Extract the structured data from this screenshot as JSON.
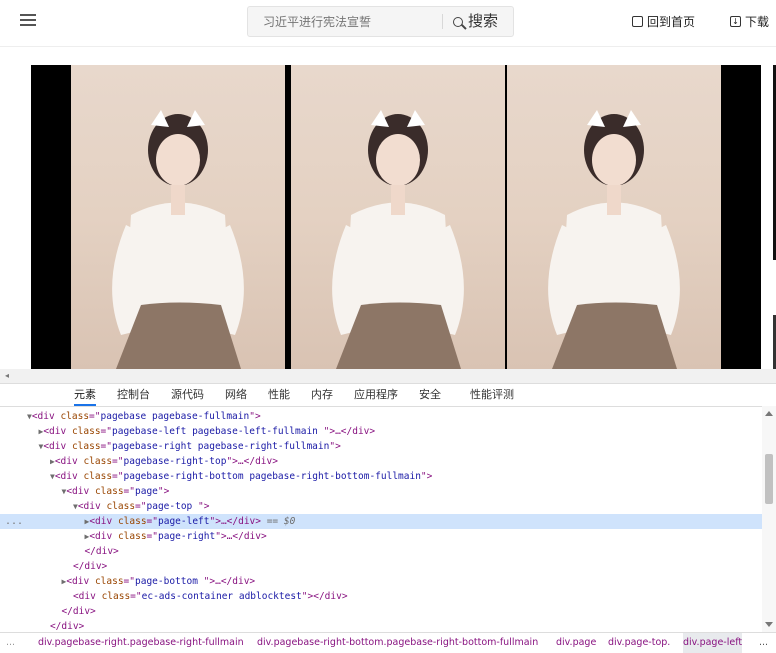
{
  "header": {
    "search_placeholder": "习近平进行宪法宣誓",
    "search_button": "搜索",
    "home_link": "回到首页",
    "download_link": "下载"
  },
  "devtools": {
    "tabs": [
      "元素",
      "控制台",
      "源代码",
      "网络",
      "性能",
      "内存",
      "应用程序",
      "安全",
      "性能评测"
    ],
    "active_tab": "元素",
    "gutter": "...",
    "selected_marker": "== $0",
    "dom_lines": [
      {
        "indent": 1,
        "arrow": "▼",
        "open": "<div",
        "cls": "pagebase pagebase-fullmain",
        "close": "\">",
        "tail": ""
      },
      {
        "indent": 2,
        "arrow": "▶",
        "open": "<div",
        "cls": "pagebase-left pagebase-left-fullmain ",
        "close": "\">",
        "tail": "…</div>"
      },
      {
        "indent": 2,
        "arrow": "▼",
        "open": "<div",
        "cls": "pagebase-right pagebase-right-fullmain",
        "close": "\">",
        "tail": ""
      },
      {
        "indent": 3,
        "arrow": "▶",
        "open": "<div",
        "cls": "pagebase-right-top",
        "close": "\">",
        "tail": "…</div>"
      },
      {
        "indent": 3,
        "arrow": "▼",
        "open": "<div",
        "cls": "pagebase-right-bottom pagebase-right-bottom-fullmain",
        "close": "\">",
        "tail": ""
      },
      {
        "indent": 4,
        "arrow": "▼",
        "open": "<div",
        "cls": "page",
        "close": "\">",
        "tail": ""
      },
      {
        "indent": 5,
        "arrow": "▼",
        "open": "<div",
        "cls": "page-top ",
        "close": "\">",
        "tail": ""
      },
      {
        "indent": 6,
        "arrow": "▶",
        "open": "<div",
        "cls": "page-left",
        "close": "\">",
        "tail": "…</div>"
      },
      {
        "indent": 6,
        "arrow": "▶",
        "open": "<div",
        "cls": "page-right",
        "close": "\">",
        "tail": "…</div>"
      },
      {
        "indent": 5,
        "arrow": "",
        "open": "</div>",
        "cls": null,
        "close": "",
        "tail": ""
      },
      {
        "indent": 4,
        "arrow": "",
        "open": "</div>",
        "cls": null,
        "close": "",
        "tail": ""
      },
      {
        "indent": 4,
        "arrow": "▶",
        "open": "<div",
        "cls": "page-bottom ",
        "close": "\">",
        "tail": "…</div>"
      },
      {
        "indent": 4,
        "arrow": "",
        "open": "<div",
        "cls": "ec-ads-container adblocktest",
        "close": "\">",
        "tail": "</div>"
      },
      {
        "indent": 3,
        "arrow": "",
        "open": "</div>",
        "cls": null,
        "close": "",
        "tail": ""
      },
      {
        "indent": 2,
        "arrow": "",
        "open": "</div>",
        "cls": null,
        "close": "",
        "tail": ""
      }
    ],
    "selected_index": 7,
    "breadcrumbs": [
      "...",
      "div.pagebase-right.pagebase-right-fullmain",
      "div.pagebase-right-bottom.pagebase-right-bottom-fullmain",
      "div.page",
      "div.page-top.",
      "div.page-left",
      "..."
    ],
    "active_crumb": 5
  }
}
